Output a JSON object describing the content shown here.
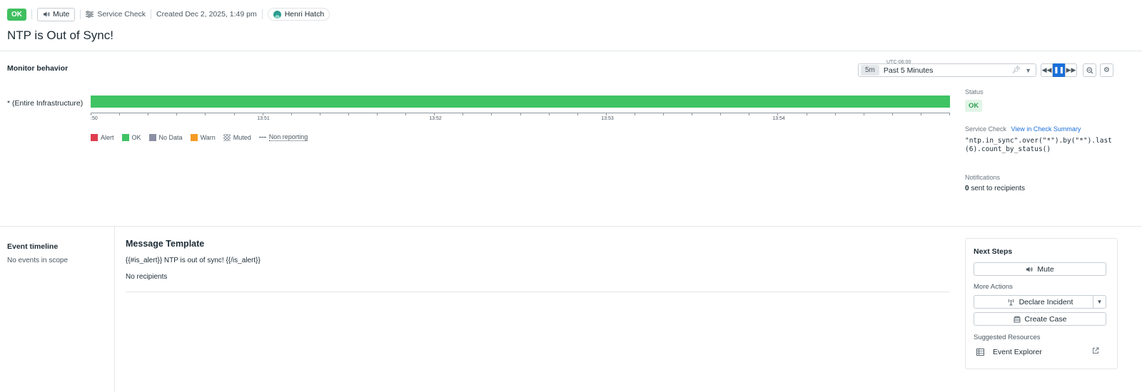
{
  "header": {
    "status_badge": "OK",
    "mute_label": "Mute",
    "monitor_type": "Service Check",
    "created": "Created Dec 2, 2025, 1:49 pm",
    "user": "Henri Hatch",
    "title": "NTP is Out of Sync!"
  },
  "monitor_behavior": {
    "title": "Monitor behavior",
    "timepicker": {
      "timezone": "UTC-06:00",
      "chip": "5m",
      "label": "Past 5 Minutes"
    },
    "group_label": "* (Entire Infrastructure)",
    "axis_labels": [
      ":50",
      "13:51",
      "13:52",
      "13:53",
      "13:54"
    ],
    "legend": {
      "alert": "Alert",
      "ok": "OK",
      "no_data": "No Data",
      "warn": "Warn",
      "muted": "Muted",
      "non_reporting": "Non reporting"
    },
    "colors": {
      "ok": "#3fc363",
      "alert": "#e03c4f",
      "no_data": "#8a8fa3",
      "warn": "#f59b23"
    }
  },
  "side": {
    "status_label": "Status",
    "status_value": "OK",
    "service_check_label": "Service Check",
    "view_link": "View in Check Summary",
    "query_line1": "\"ntp.in_sync\".over(\"*\").by(\"*\").last",
    "query_line2": "(6).count_by_status()",
    "notifications_label": "Notifications",
    "notifications_count": "0",
    "notifications_text": "sent to recipients"
  },
  "event_timeline": {
    "title": "Event timeline",
    "empty": "No events in scope"
  },
  "message": {
    "title": "Message Template",
    "body": "{{#is_alert}} NTP is out of sync! {{/is_alert}}",
    "recipients": "No recipients"
  },
  "next_steps": {
    "title": "Next Steps",
    "mute": "Mute",
    "more_actions": "More Actions",
    "declare_incident": "Declare Incident",
    "create_case": "Create Case",
    "suggested": "Suggested Resources",
    "event_explorer": "Event Explorer"
  }
}
